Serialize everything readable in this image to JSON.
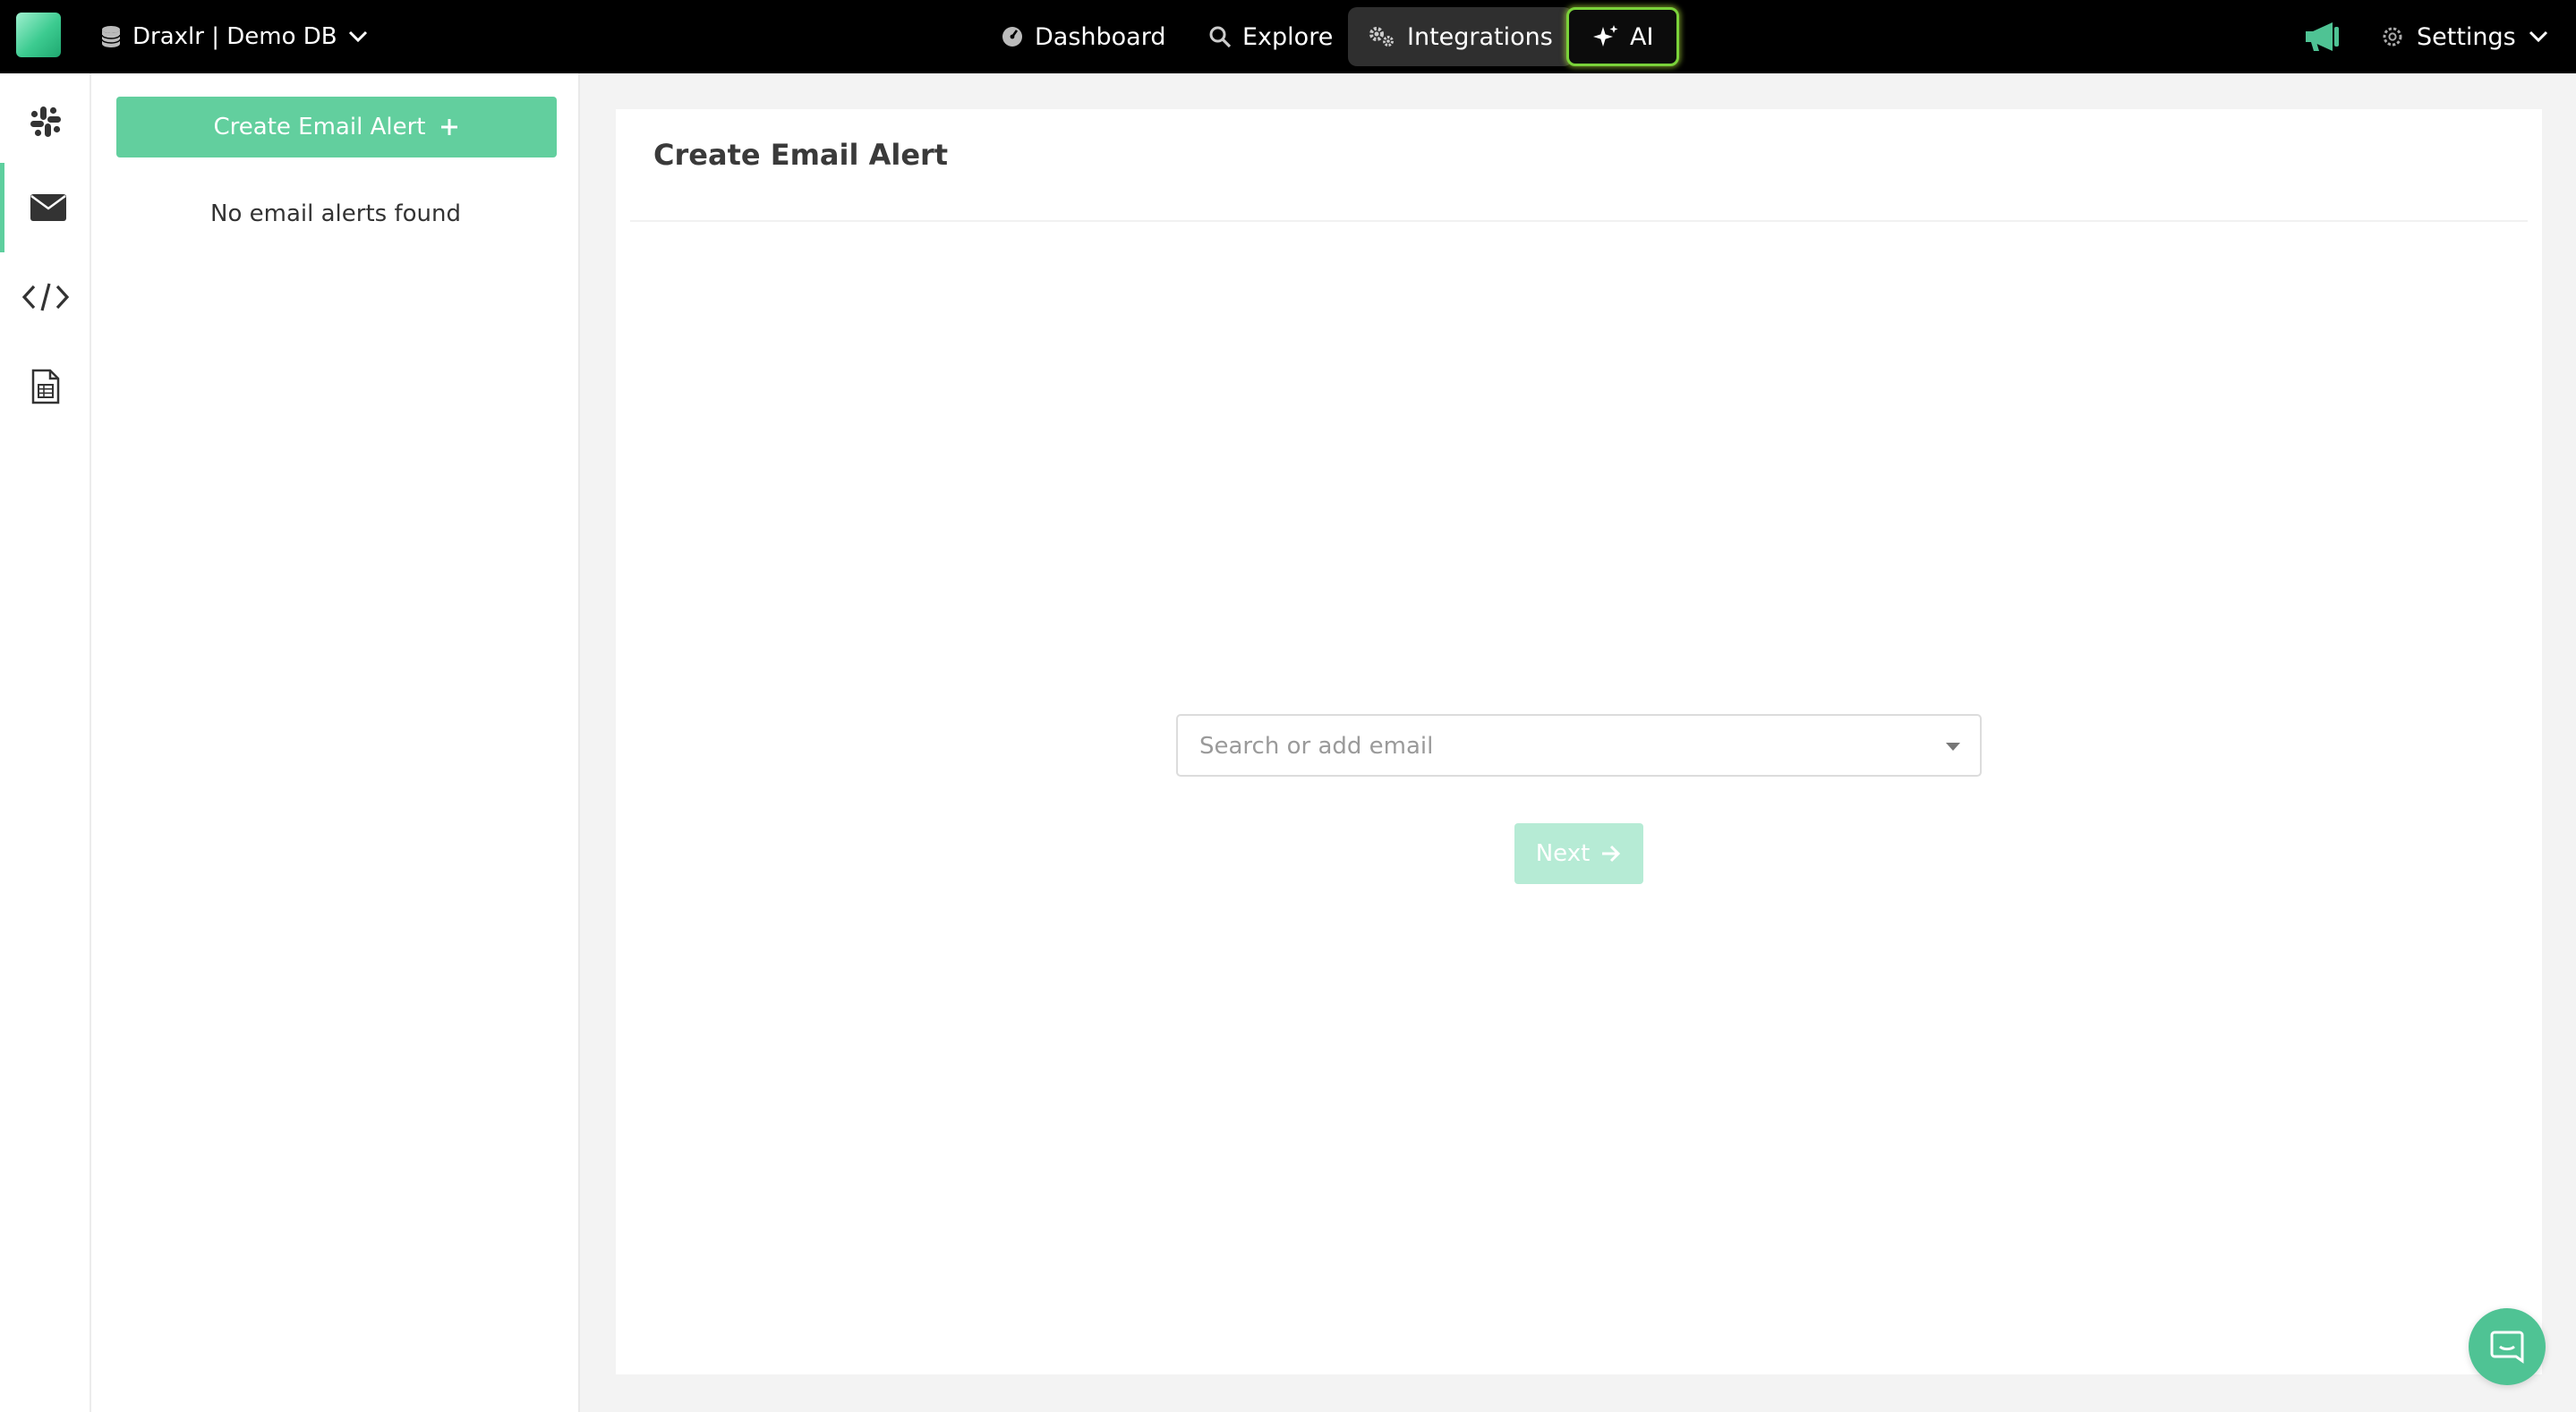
{
  "header": {
    "db_selector": "Draxlr | Demo DB",
    "nav": [
      {
        "label": "Dashboard",
        "icon": "dashboard-gauge-icon"
      },
      {
        "label": "Explore",
        "icon": "search-icon"
      },
      {
        "label": "Integrations",
        "icon": "gears-icon",
        "active": true
      },
      {
        "label": "AI",
        "icon": "sparkle-icon"
      }
    ],
    "settings_label": "Settings"
  },
  "rail": {
    "items": [
      {
        "icon": "slack-icon"
      },
      {
        "icon": "envelope-icon",
        "active": true
      },
      {
        "icon": "code-embed-icon"
      },
      {
        "icon": "sheet-icon"
      }
    ]
  },
  "alerts_panel": {
    "create_button_label": "Create Email Alert",
    "empty_message": "No email alerts found"
  },
  "main": {
    "title": "Create Email Alert",
    "email_placeholder": "Search or add email",
    "next_label": "Next"
  },
  "colors": {
    "accent": "#62cf9e",
    "accent_disabled": "#b6ebd5",
    "topbar": "#000000",
    "ai_glow": "#7ad23a"
  }
}
